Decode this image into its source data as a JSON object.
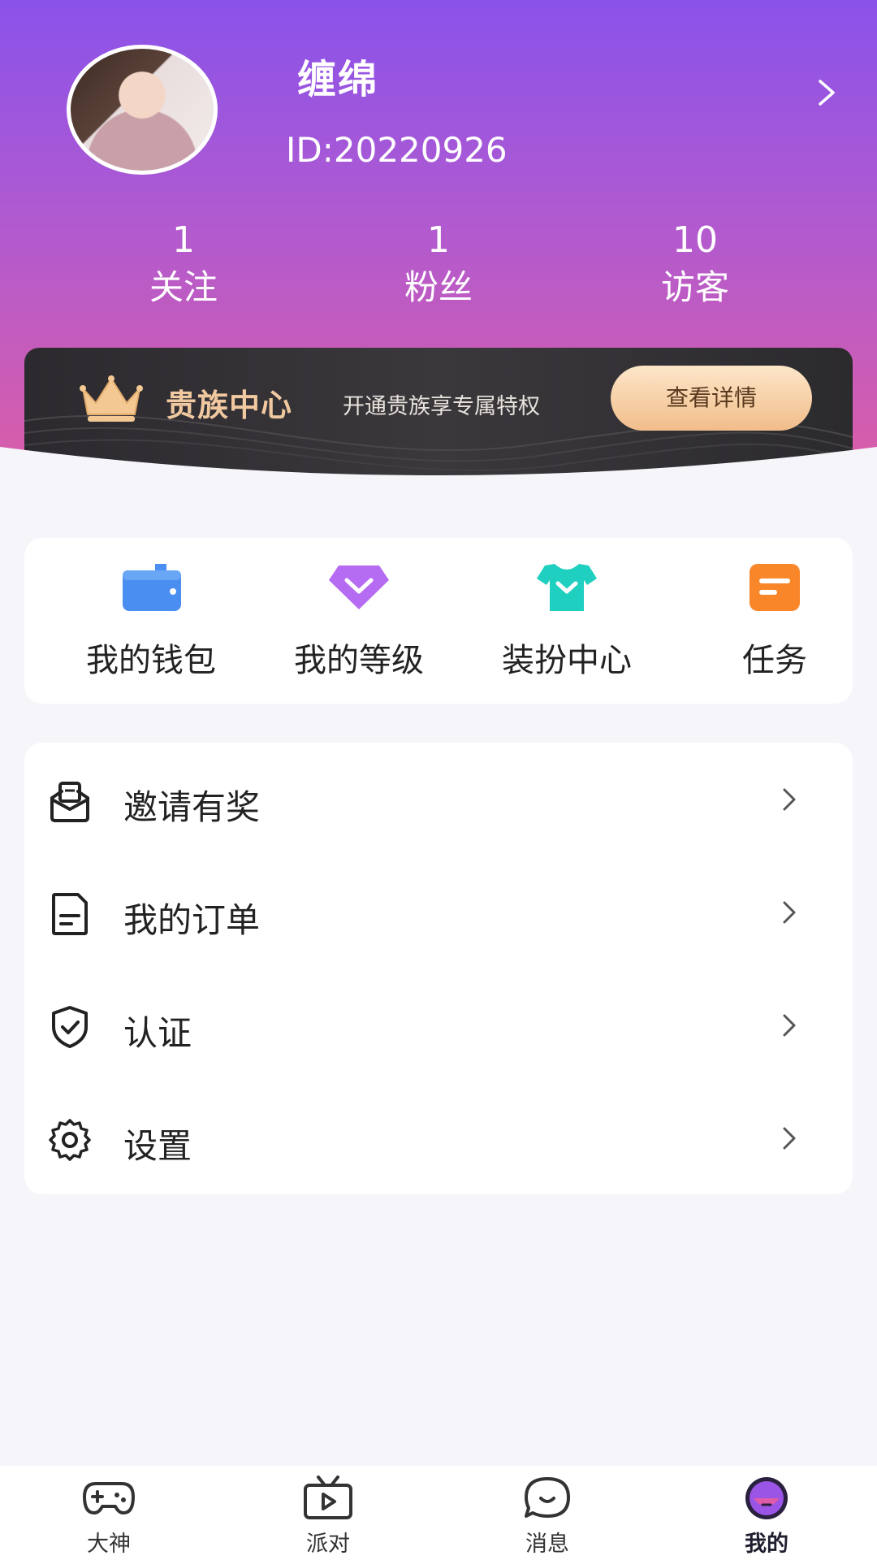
{
  "profile": {
    "name": "缠绵",
    "id_text": "ID:20220926"
  },
  "stats": [
    {
      "value": "1",
      "label": "关注"
    },
    {
      "value": "1",
      "label": "粉丝"
    },
    {
      "value": "10",
      "label": "访客"
    }
  ],
  "vip": {
    "title": "贵族中心",
    "desc": "开通贵族享专属特权",
    "button": "查看详情"
  },
  "quick": [
    {
      "label": "我的钱包",
      "icon": "wallet-icon"
    },
    {
      "label": "我的等级",
      "icon": "diamond-level-icon"
    },
    {
      "label": "装扮中心",
      "icon": "shirt-icon"
    },
    {
      "label": "任务",
      "icon": "task-icon"
    }
  ],
  "menu": [
    {
      "label": "邀请有奖",
      "icon": "invite-gift-icon"
    },
    {
      "label": "我的订单",
      "icon": "order-document-icon"
    },
    {
      "label": "认证",
      "icon": "shield-check-icon"
    },
    {
      "label": "设置",
      "icon": "gear-icon"
    }
  ],
  "tabs": [
    {
      "label": "大神",
      "icon": "gamepad-icon"
    },
    {
      "label": "派对",
      "icon": "tv-play-icon"
    },
    {
      "label": "消息",
      "icon": "chat-bubble-icon"
    },
    {
      "label": "我的",
      "icon": "profile-avatar-icon",
      "active": true
    }
  ],
  "colors": {
    "header_top": "#8a52ea",
    "header_bottom": "#dc5ea6",
    "vip_gold": "#f1c9a0",
    "wallet_blue": "#4a8ef2",
    "level_purple": "#b56cf2",
    "shirt_teal": "#1fcfc0",
    "task_orange": "#f9872a"
  }
}
